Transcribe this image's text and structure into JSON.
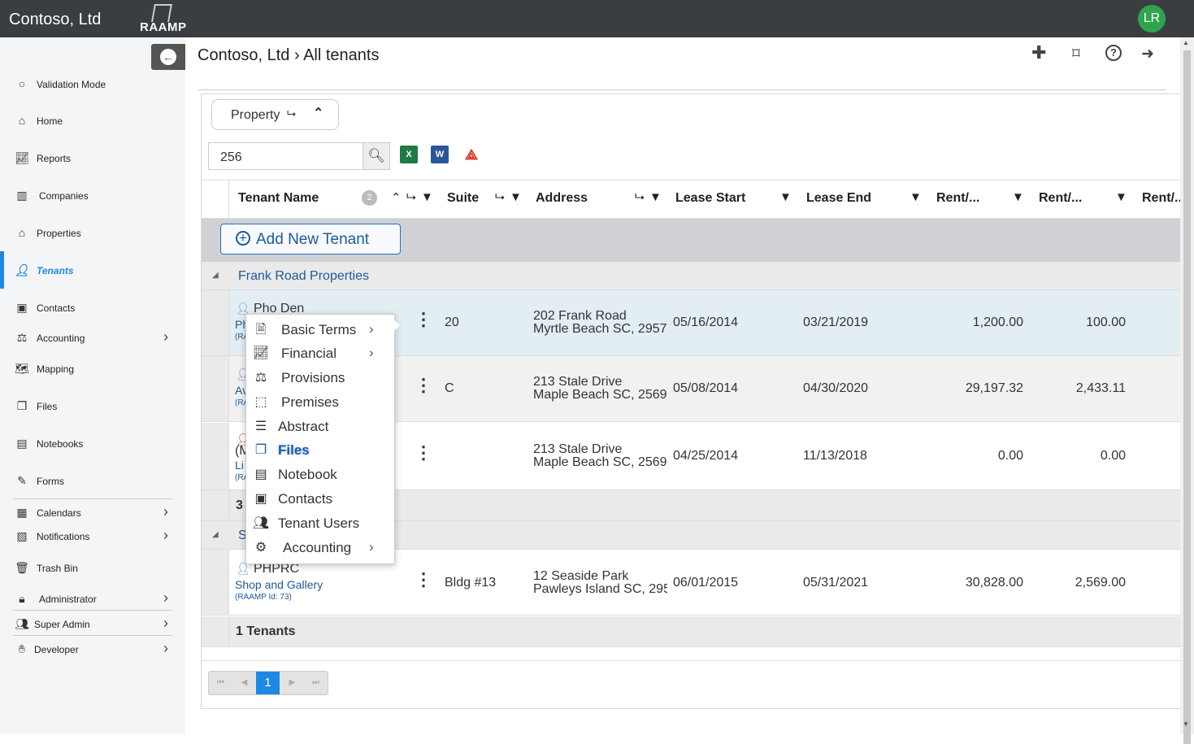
{
  "app": {
    "brand": "Contoso, Ltd",
    "logo_text": "RAAMP",
    "avatar": "LR"
  },
  "breadcrumb": "Contoso, Ltd › All tenants",
  "sidebar": {
    "items": [
      {
        "label": "Validation Mode",
        "icon": "circle-icon"
      },
      {
        "label": "Home",
        "icon": "home-icon"
      },
      {
        "label": "Reports",
        "icon": "chart-icon"
      },
      {
        "label": "Companies",
        "icon": "building-icon"
      },
      {
        "label": "Properties",
        "icon": "home-icon"
      },
      {
        "label": "Tenants",
        "icon": "user-icon"
      },
      {
        "label": "Contacts",
        "icon": "contact-card-icon"
      },
      {
        "label": "Accounting",
        "icon": "scale-icon"
      },
      {
        "label": "Mapping",
        "icon": "map-icon"
      },
      {
        "label": "Files",
        "icon": "files-icon"
      },
      {
        "label": "Notebooks",
        "icon": "notebook-icon"
      },
      {
        "label": "Forms",
        "icon": "form-icon"
      },
      {
        "label": "Calendars",
        "icon": "calendar-icon"
      },
      {
        "label": "Notifications",
        "icon": "notification-icon"
      },
      {
        "label": "Trash Bin",
        "icon": "trash-icon"
      },
      {
        "label": "Administrator",
        "icon": "lock-icon"
      },
      {
        "label": "Super Admin",
        "icon": "users-gear-icon"
      },
      {
        "label": "Developer",
        "icon": "code-icon"
      }
    ]
  },
  "toolbar": {
    "property_label": "Property",
    "search_value": "256"
  },
  "columns": {
    "tenant": "Tenant Name",
    "sort_badge": "2",
    "suite": "Suite",
    "address": "Address",
    "lease_start": "Lease Start",
    "lease_end": "Lease End",
    "rent1": "Rent/...",
    "rent2": "Rent/...",
    "rent3": "Rent/..."
  },
  "add_tenant": "Add New Tenant",
  "groups": [
    {
      "name": "Frank Road Properties",
      "rows": [
        {
          "name": "Pho Den",
          "sub": "Ph",
          "id": "(RA",
          "suite": "20",
          "addr1": "202 Frank Road",
          "addr2": "Myrtle Beach SC, 2957",
          "start": "05/16/2014",
          "end": "03/21/2019",
          "rent1": "1,200.00",
          "rent2": "100.00"
        },
        {
          "name": "",
          "sub": "Av",
          "id": "(RA",
          "suite": "C",
          "addr1": "213 Stale Drive",
          "addr2": "Maple Beach SC, 2569",
          "start": "05/08/2014",
          "end": "04/30/2020",
          "rent1": "29,197.32",
          "rent2": "2,433.11"
        },
        {
          "name": "(M",
          "sub": "Li",
          "id": "(RA",
          "suite": "",
          "addr1": "213 Stale Drive",
          "addr2": "Maple Beach SC, 2569",
          "start": "04/25/2014",
          "end": "11/13/2018",
          "rent1": "0.00",
          "rent2": "0.00"
        }
      ],
      "footer": "3"
    },
    {
      "name": "S",
      "rows": [
        {
          "name": "PHPRC",
          "sub": "Shop and Gallery",
          "id": "(RAAMP Id: 73)",
          "suite": "Bldg #13",
          "addr1": "12 Seaside Park",
          "addr2": "Pawleys Island SC, 295",
          "start": "06/01/2015",
          "end": "05/31/2021",
          "rent1": "30,828.00",
          "rent2": "2,569.00"
        }
      ],
      "footer": "1 Tenants"
    }
  ],
  "context_menu": [
    {
      "label": "Basic Terms",
      "icon": "document-icon",
      "submenu": true
    },
    {
      "label": "Financial",
      "icon": "financial-chart-icon",
      "submenu": true
    },
    {
      "label": "Provisions",
      "icon": "scale-icon",
      "submenu": false
    },
    {
      "label": "Premises",
      "icon": "premises-icon",
      "submenu": false
    },
    {
      "label": "Abstract",
      "icon": "abstract-icon",
      "submenu": false
    },
    {
      "label": "Files",
      "icon": "files-icon",
      "submenu": false
    },
    {
      "label": "Notebook",
      "icon": "notebook-icon",
      "submenu": false
    },
    {
      "label": "Contacts",
      "icon": "contact-card-icon",
      "submenu": false
    },
    {
      "label": "Tenant Users",
      "icon": "users-icon",
      "submenu": false
    },
    {
      "label": "Accounting",
      "icon": "gears-icon",
      "submenu": true
    }
  ],
  "pager": {
    "page": "1"
  },
  "colors": {
    "topbar": "#3a3d42",
    "accent": "#1e88e5",
    "link": "#1c5a9a",
    "avatar": "#2ea44f"
  }
}
